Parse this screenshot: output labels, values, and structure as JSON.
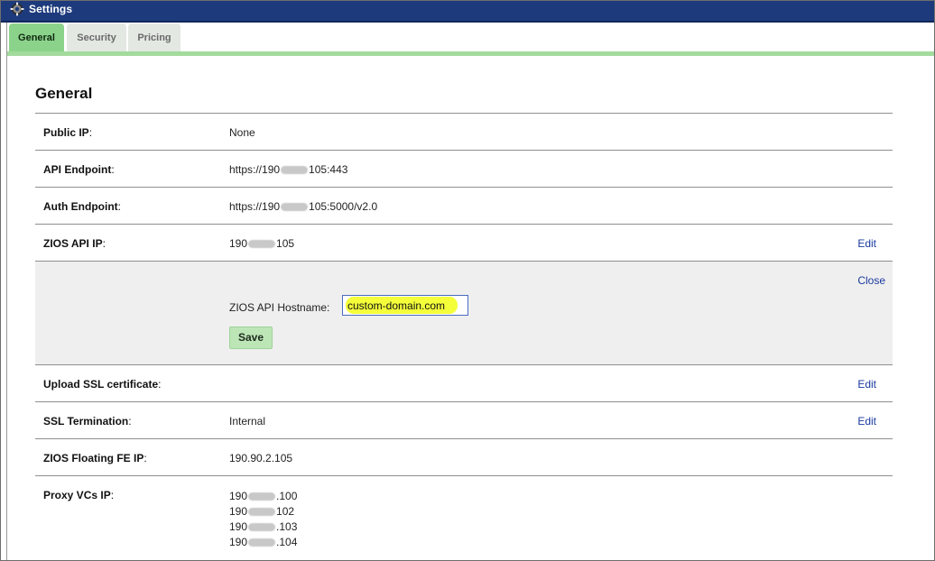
{
  "window": {
    "title": "Settings",
    "icon": "gear-icon"
  },
  "tabs": [
    {
      "label": "General",
      "active": true
    },
    {
      "label": "Security",
      "active": false
    },
    {
      "label": "Pricing",
      "active": false
    }
  ],
  "page": {
    "heading": "General"
  },
  "rows": {
    "public_ip": {
      "label": "Public IP",
      "value": "None"
    },
    "api_endpoint": {
      "label": "API Endpoint",
      "value_prefix": "https://190",
      "value_suffix": "105:443"
    },
    "auth_endpoint": {
      "label": "Auth Endpoint",
      "value_prefix": "https://190",
      "value_suffix": "105:5000/v2.0"
    },
    "zios_api_ip": {
      "label": "ZIOS API IP",
      "value_prefix": "190",
      "value_suffix": "105",
      "action": "Edit"
    },
    "upload_ssl": {
      "label": "Upload SSL certificate",
      "action": "Edit"
    },
    "ssl_termination": {
      "label": "SSL Termination",
      "value": "Internal",
      "action": "Edit"
    },
    "floating_fe_ip": {
      "label": "ZIOS Floating FE IP",
      "value": "190.90.2.105"
    },
    "proxy_vcs_ip": {
      "label": "Proxy VCs IP",
      "items": [
        {
          "prefix": "190",
          "suffix": ".100"
        },
        {
          "prefix": "190",
          "suffix": "102"
        },
        {
          "prefix": "190",
          "suffix": ".103"
        },
        {
          "prefix": "190",
          "suffix": ".104"
        }
      ]
    }
  },
  "edit_panel": {
    "close_label": "Close",
    "hostname_label": "ZIOS API Hostname:",
    "hostname_value": "custom-domain.com",
    "save_label": "Save"
  },
  "colors": {
    "titlebar": "#1d3a7c",
    "active_tab": "#8bd38b",
    "tab_underline": "#a3db9c",
    "link": "#1a3aa0",
    "highlight": "#f4ff3a",
    "save_button": "#bde6b7"
  }
}
